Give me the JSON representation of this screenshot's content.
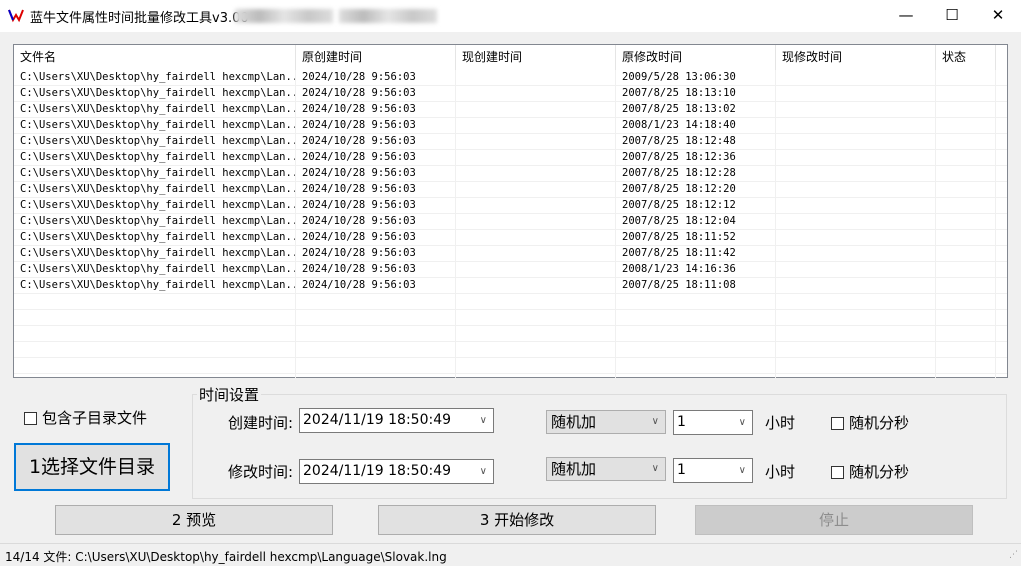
{
  "window": {
    "title": "蓝牛文件属性时间批量修改工具v3.00",
    "min": "—",
    "max": "☐",
    "close": "✕"
  },
  "list": {
    "columns": [
      "文件名",
      "原创建时间",
      "现创建时间",
      "原修改时间",
      "现修改时间",
      "状态"
    ],
    "rows": [
      [
        "C:\\Users\\XU\\Desktop\\hy_fairdell hexcmp\\Lan...",
        "2024/10/28 9:56:03",
        "",
        "2009/5/28 13:06:30",
        "",
        ""
      ],
      [
        "C:\\Users\\XU\\Desktop\\hy_fairdell hexcmp\\Lan...",
        "2024/10/28 9:56:03",
        "",
        "2007/8/25 18:13:10",
        "",
        ""
      ],
      [
        "C:\\Users\\XU\\Desktop\\hy_fairdell hexcmp\\Lan...",
        "2024/10/28 9:56:03",
        "",
        "2007/8/25 18:13:02",
        "",
        ""
      ],
      [
        "C:\\Users\\XU\\Desktop\\hy_fairdell hexcmp\\Lan...",
        "2024/10/28 9:56:03",
        "",
        "2008/1/23 14:18:40",
        "",
        ""
      ],
      [
        "C:\\Users\\XU\\Desktop\\hy_fairdell hexcmp\\Lan...",
        "2024/10/28 9:56:03",
        "",
        "2007/8/25 18:12:48",
        "",
        ""
      ],
      [
        "C:\\Users\\XU\\Desktop\\hy_fairdell hexcmp\\Lan...",
        "2024/10/28 9:56:03",
        "",
        "2007/8/25 18:12:36",
        "",
        ""
      ],
      [
        "C:\\Users\\XU\\Desktop\\hy_fairdell hexcmp\\Lan...",
        "2024/10/28 9:56:03",
        "",
        "2007/8/25 18:12:28",
        "",
        ""
      ],
      [
        "C:\\Users\\XU\\Desktop\\hy_fairdell hexcmp\\Lan...",
        "2024/10/28 9:56:03",
        "",
        "2007/8/25 18:12:20",
        "",
        ""
      ],
      [
        "C:\\Users\\XU\\Desktop\\hy_fairdell hexcmp\\Lan...",
        "2024/10/28 9:56:03",
        "",
        "2007/8/25 18:12:12",
        "",
        ""
      ],
      [
        "C:\\Users\\XU\\Desktop\\hy_fairdell hexcmp\\Lan...",
        "2024/10/28 9:56:03",
        "",
        "2007/8/25 18:12:04",
        "",
        ""
      ],
      [
        "C:\\Users\\XU\\Desktop\\hy_fairdell hexcmp\\Lan...",
        "2024/10/28 9:56:03",
        "",
        "2007/8/25 18:11:52",
        "",
        ""
      ],
      [
        "C:\\Users\\XU\\Desktop\\hy_fairdell hexcmp\\Lan...",
        "2024/10/28 9:56:03",
        "",
        "2007/8/25 18:11:42",
        "",
        ""
      ],
      [
        "C:\\Users\\XU\\Desktop\\hy_fairdell hexcmp\\Lan...",
        "2024/10/28 9:56:03",
        "",
        "2008/1/23 14:16:36",
        "",
        ""
      ],
      [
        "C:\\Users\\XU\\Desktop\\hy_fairdell hexcmp\\Lan...",
        "2024/10/28 9:56:03",
        "",
        "2007/8/25 18:11:08",
        "",
        ""
      ]
    ]
  },
  "options": {
    "include_subdirs": "包含子目录文件",
    "select_dir": "1选择文件目录"
  },
  "time_settings": {
    "legend": "时间设置",
    "create": {
      "label": "创建时间:",
      "value": "2024/11/19 18:50:49",
      "mode": "随机加",
      "amount": "1",
      "unit": "小时",
      "random": "随机分秒"
    },
    "modify": {
      "label": "修改时间:",
      "value": "2024/11/19 18:50:49",
      "mode": "随机加",
      "amount": "1",
      "unit": "小时",
      "random": "随机分秒"
    }
  },
  "actions": {
    "preview": "2 预览",
    "start": "3 开始修改",
    "stop": "停止"
  },
  "status": "14/14 文件: C:\\Users\\XU\\Desktop\\hy_fairdell hexcmp\\Language\\Slovak.lng"
}
